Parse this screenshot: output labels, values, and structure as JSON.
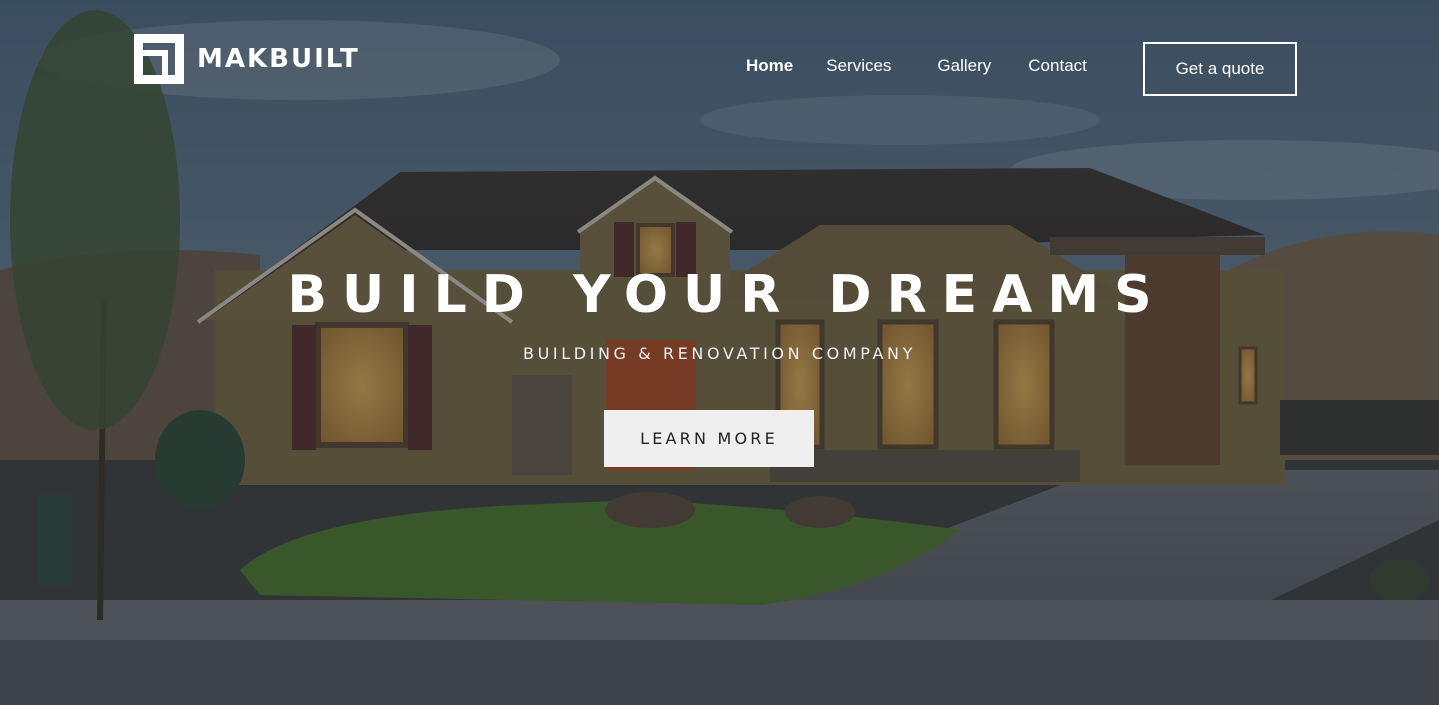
{
  "brand": {
    "name": "MAKBUILT",
    "logo_icon": "makbuilt-square-logo-icon"
  },
  "nav": {
    "items": [
      {
        "label": "Home",
        "active": true
      },
      {
        "label": "Services",
        "active": false
      },
      {
        "label": "Gallery",
        "active": false
      },
      {
        "label": "Contact",
        "active": false
      }
    ],
    "cta_label": "Get a quote"
  },
  "hero": {
    "headline": "BUILD YOUR DREAMS",
    "subheadline": "BUILDING & RENOVATION COMPANY",
    "button_label": "LEARN MORE"
  },
  "colors": {
    "text": "#ffffff",
    "button_bg": "#efefef",
    "button_text": "#222222",
    "overlay": "#1e252c"
  }
}
